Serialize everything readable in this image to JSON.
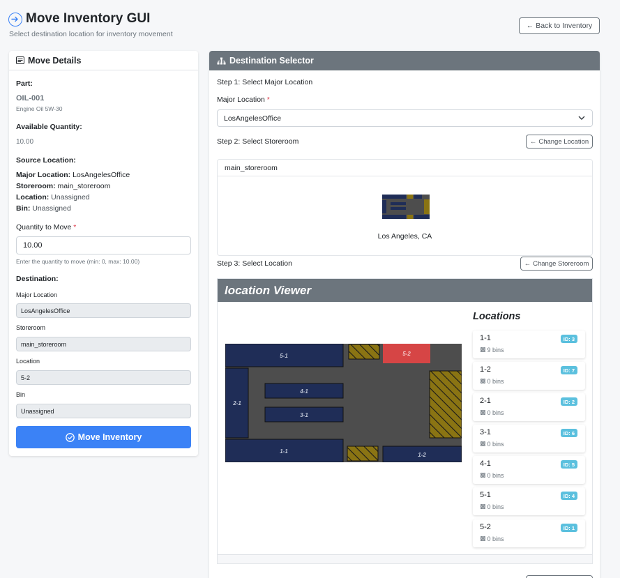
{
  "header": {
    "title": "Move Inventory GUI",
    "subtitle": "Select destination location for inventory movement",
    "back_label": "Back to Inventory",
    "back_arrow": "←"
  },
  "move_details": {
    "title": "Move Details",
    "part_label": "Part:",
    "part_code": "OIL-001",
    "part_desc": "Engine Oil 5W-30",
    "avail_label": "Available Quantity:",
    "avail_value": "10.00",
    "source_label": "Source Location:",
    "source": {
      "major_label": "Major Location:",
      "major_value": "LosAngelesOffice",
      "storeroom_label": "Storeroom:",
      "storeroom_value": "main_storeroom",
      "location_label": "Location:",
      "location_value": "Unassigned",
      "bin_label": "Bin:",
      "bin_value": "Unassigned"
    },
    "qty_label": "Quantity to Move",
    "qty_required": "*",
    "qty_value": "10.00",
    "qty_help": "Enter the quantity to move (min: 0, max: 10.00)",
    "dest_label": "Destination:",
    "dest": {
      "major_label": "Major Location",
      "major_value": "LosAngelesOffice",
      "storeroom_label": "Storeroom",
      "storeroom_value": "main_storeroom",
      "location_label": "Location",
      "location_value": "5-2",
      "bin_label": "Bin",
      "bin_value": "Unassigned"
    },
    "move_button": "Move Inventory"
  },
  "selector": {
    "title": "Destination Selector",
    "step1": "Step 1: Select Major Location",
    "major_label": "Major Location",
    "major_required": "*",
    "major_selected": "LosAngelesOffice",
    "step2": "Step 2: Select Storeroom",
    "change_location": "Change Location",
    "storeroom_name": "main_storeroom",
    "storeroom_city": "Los Angeles, CA",
    "step3": "Step 3: Select Location",
    "change_storeroom": "Change Storeroom",
    "arrow": "←"
  },
  "viewer": {
    "title": "location Viewer",
    "list_title": "Locations",
    "locations": [
      {
        "name": "1-1",
        "bins": "9 bins",
        "badge": "ID: 3"
      },
      {
        "name": "1-2",
        "bins": "0 bins",
        "badge": "ID: 7"
      },
      {
        "name": "2-1",
        "bins": "0 bins",
        "badge": "ID: 2"
      },
      {
        "name": "3-1",
        "bins": "0 bins",
        "badge": "ID: 6"
      },
      {
        "name": "4-1",
        "bins": "0 bins",
        "badge": "ID: 5"
      },
      {
        "name": "5-1",
        "bins": "0 bins",
        "badge": "ID: 4"
      },
      {
        "name": "5-2",
        "bins": "0 bins",
        "badge": "ID: 1"
      }
    ],
    "map_labels": {
      "a": "5-1",
      "b": "5-2",
      "c": "2-1",
      "d": "4-1",
      "e": "3-1",
      "f": "1-1",
      "g": "1-2"
    },
    "selected_location": "5-2"
  },
  "colors": {
    "primary": "#3b82f6",
    "header_gray": "#6c757d",
    "navy": "#1f2d57",
    "selected_red": "#d64545",
    "hazard": "#8a7413",
    "floor": "#4d4d4d",
    "badge": "#5bc0de"
  }
}
